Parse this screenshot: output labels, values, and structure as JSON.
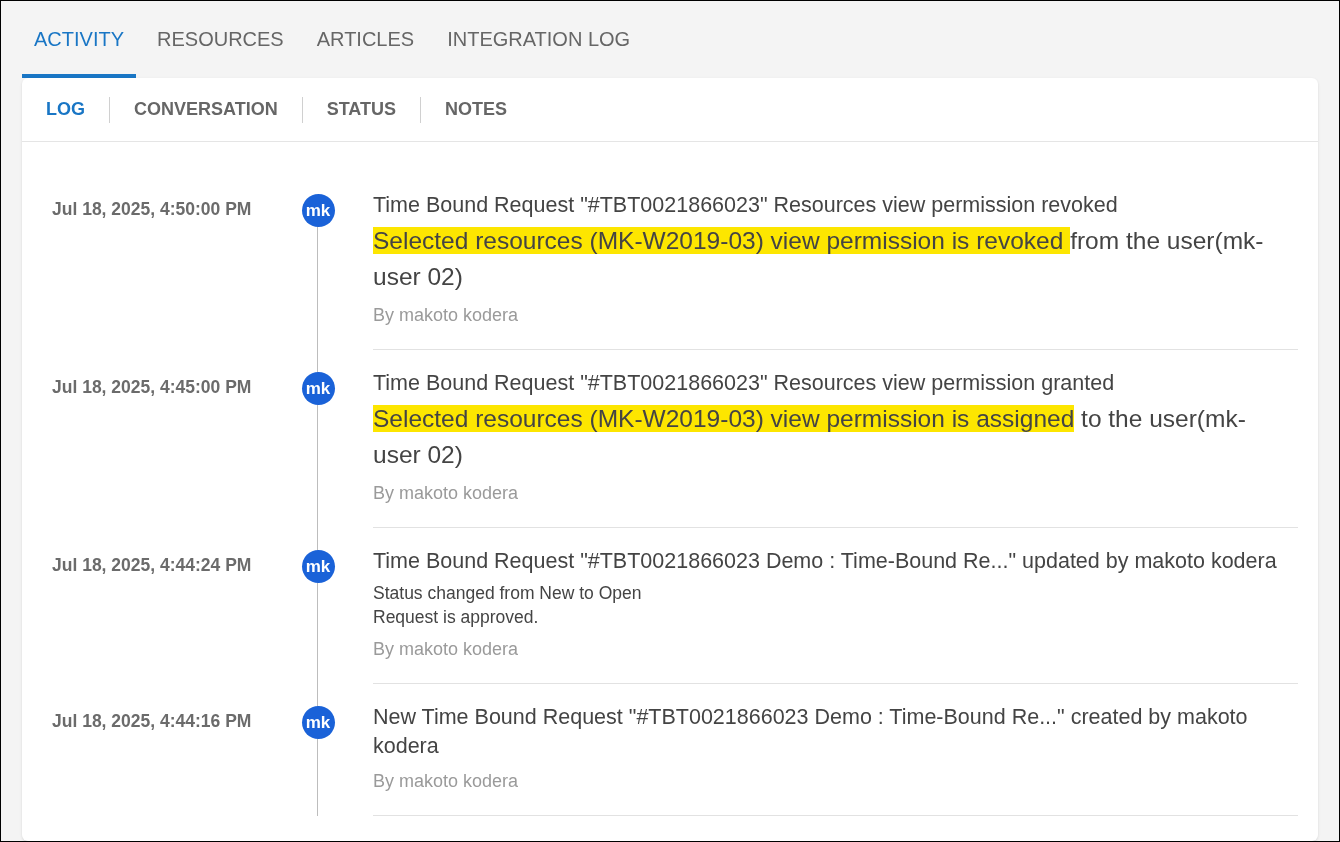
{
  "tabs": [
    {
      "label": "ACTIVITY",
      "selected": true
    },
    {
      "label": "RESOURCES",
      "selected": false
    },
    {
      "label": "ARTICLES",
      "selected": false
    },
    {
      "label": "INTEGRATION LOG",
      "selected": false
    }
  ],
  "subtabs": [
    {
      "label": "LOG",
      "selected": true
    },
    {
      "label": "CONVERSATION",
      "selected": false
    },
    {
      "label": "STATUS",
      "selected": false
    },
    {
      "label": "NOTES",
      "selected": false
    }
  ],
  "entries": [
    {
      "date": "Jul 18, 2025, 4:50:00 PM",
      "avatar": "mk",
      "title": "Time Bound Request \"#TBT0021866023\" Resources view permission revoked",
      "details": [
        {
          "kind": "emphasis",
          "segments": [
            {
              "text": "Selected resources (MK-W2019-03) view permission is revoked ",
              "highlighted": true
            },
            {
              "text": "from the user(mk-user 02)",
              "highlighted": false
            }
          ]
        }
      ],
      "by": "By makoto kodera"
    },
    {
      "date": "Jul 18, 2025, 4:45:00 PM",
      "avatar": "mk",
      "title": "Time Bound Request \"#TBT0021866023\" Resources view permission granted",
      "details": [
        {
          "kind": "emphasis",
          "segments": [
            {
              "text": "Selected resources (MK-W2019-03) view permission is assigned",
              "highlighted": true
            },
            {
              "text": " to the user(mk-user 02)",
              "highlighted": false
            }
          ]
        }
      ],
      "by": "By makoto kodera"
    },
    {
      "date": "Jul 18, 2025, 4:44:24 PM",
      "avatar": "mk",
      "title": "Time Bound Request \"#TBT0021866023 Demo : Time-Bound Re...\" updated by makoto kodera",
      "details": [
        {
          "kind": "note",
          "segments": [
            {
              "text": "Status changed from New to Open",
              "highlighted": false
            }
          ]
        },
        {
          "kind": "note",
          "segments": [
            {
              "text": "Request is approved.",
              "highlighted": false
            }
          ]
        }
      ],
      "by": "By makoto kodera"
    },
    {
      "date": "Jul 18, 2025, 4:44:16 PM",
      "avatar": "mk",
      "title": "New Time Bound Request \"#TBT0021866023 Demo : Time-Bound Re...\" created by makoto kodera",
      "by": "By makoto kodera"
    }
  ]
}
